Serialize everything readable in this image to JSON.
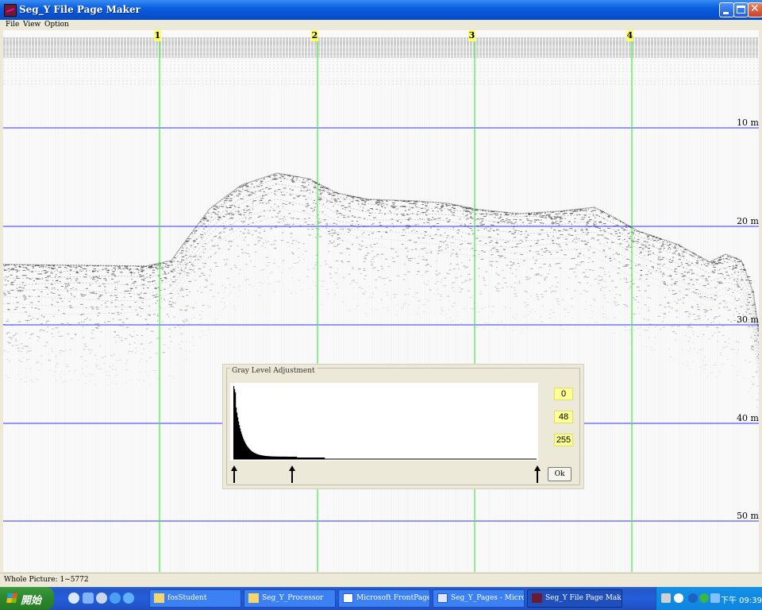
{
  "window": {
    "title": "Seg_Y File Page Maker",
    "controls": {
      "minimize": "minimize-icon",
      "maximize": "maximize-icon",
      "close": "close-icon",
      "close_glyph": "✕"
    }
  },
  "menu": [
    "File",
    "View",
    "Option"
  ],
  "seismic_view": {
    "trace_markers": [
      "1",
      "2",
      "3",
      "4"
    ],
    "depth_labels": [
      "10 m",
      "20 m",
      "30 m",
      "40 m",
      "50 m"
    ],
    "marker_line_color": "#44ee44",
    "depth_line_color": "#3333ff"
  },
  "dialog": {
    "title": "Gray Level Adjustment",
    "values": {
      "low": "0",
      "mid": "48",
      "high": "255"
    },
    "ok_label": "Ok",
    "value_box_color": "#ffff99"
  },
  "status": {
    "text": "Whole Picture: 1~5772"
  },
  "taskbar": {
    "start_label": "開始",
    "tasks": [
      {
        "label": "fosStudent",
        "icon": "folder-icon"
      },
      {
        "label": "Seg_Y_Processor",
        "icon": "folder-icon"
      },
      {
        "label": "Microsoft FrontPage - ...",
        "icon": "frontpage-icon"
      },
      {
        "label": "Seg_Y_Pages - Micros...",
        "icon": "frontpage-icon"
      },
      {
        "label": "Seg_Y File Page Maker",
        "icon": "app-icon",
        "active": true
      }
    ],
    "clock": "下午 09:39"
  }
}
